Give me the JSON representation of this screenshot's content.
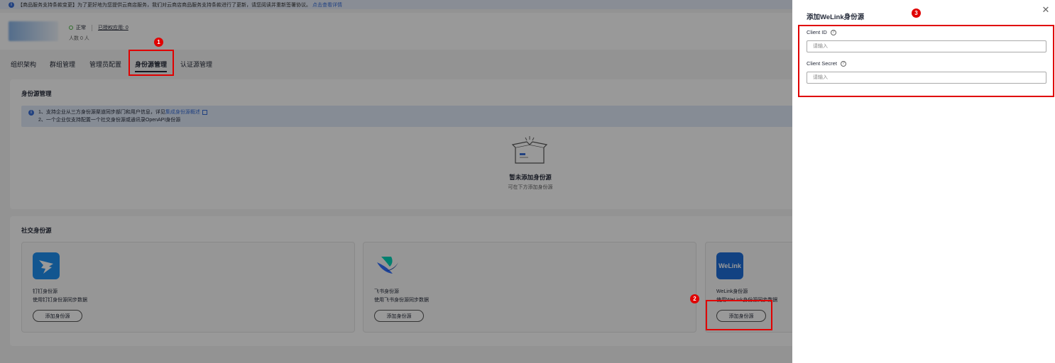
{
  "notice": {
    "text": "【商品服务支持条款变更】为了更好地为您提供云商店服务，我们对云商店商品服务支持条款进行了更新，请您阅读并重新签署协议。",
    "link": "点击查看详情"
  },
  "org": {
    "status": "正常",
    "authorized_apps": "已授权应用: 0",
    "people": "人数 0 人"
  },
  "tabs": [
    "组织架构",
    "群组管理",
    "管理员配置",
    "身份源管理",
    "认证源管理"
  ],
  "identity_section": {
    "title": "身份源管理",
    "tip_line1_prefix": "1、支持企业从三方身份源渠道同步部门和用户信息，详见",
    "tip_link": "集成身份源概述",
    "tip_line2": "2、一个企业仅支持配置一个社交身份源或通讯录OpenAPI身份源",
    "empty_title": "暂未添加身份源",
    "empty_sub": "可在下方添加身份源"
  },
  "social_section": {
    "title": "社交身份源",
    "cards": [
      {
        "name": "钉钉身份源",
        "desc": "使用钉钉身份源同步数据",
        "button": "添加身份源"
      },
      {
        "name": "飞书身份源",
        "desc": "使用飞书身份源同步数据",
        "button": "添加身份源"
      },
      {
        "name": "WeLink身份源",
        "desc": "使用WeLink身份源同步数据",
        "button": "添加身份源",
        "logo_text": "WeLink"
      }
    ]
  },
  "drawer": {
    "title": "添加WeLink身份源",
    "client_id_label": "Client ID",
    "client_id_placeholder": "请输入",
    "client_secret_label": "Client Secret",
    "client_secret_placeholder": "请输入"
  },
  "annotations": [
    "1",
    "2",
    "3"
  ],
  "colors": {
    "annotation_red": "#e00000",
    "link_blue": "#3a6fd8",
    "status_green": "#50b848",
    "dingtalk_blue": "#1f8ff0",
    "welink_blue": "#1e6fd9"
  }
}
